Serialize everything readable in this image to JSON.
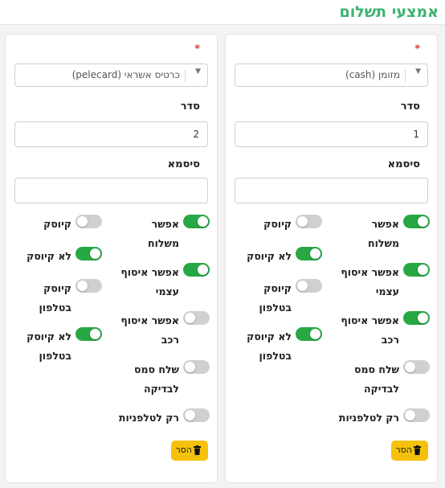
{
  "section": {
    "title": "אמצעי תשלום"
  },
  "cards": [
    {
      "required_mark": "*",
      "method_value": "מזומן (cash)",
      "order_label": "סדר",
      "order_value": "1",
      "password_label": "סיסמא",
      "password_value": "",
      "toggles": {
        "allow_delivery": {
          "label": "אפשר משלוח",
          "on": true
        },
        "allow_pickup": {
          "label": "אפשר איסוף עצמי",
          "on": true
        },
        "allow_car_pickup": {
          "label": "אפשר איסוף רכב",
          "on": true
        },
        "send_sms_test": {
          "label": "שלח סמס לבדיקה",
          "on": false
        },
        "phones_only": {
          "label": "רק לטלפניות",
          "on": false
        },
        "kiosk": {
          "label": "קיוסק",
          "on": false
        },
        "not_kiosk": {
          "label": "לא קיוסק",
          "on": true
        },
        "kiosk_phone": {
          "label": "קיוסק בטלפון",
          "on": false
        },
        "not_kiosk_phone": {
          "label": "לא קיוסק בטלפון",
          "on": true
        }
      },
      "remove_label": "הסר"
    },
    {
      "required_mark": "*",
      "method_value": "כרטיס אשראי (pelecard)",
      "order_label": "סדר",
      "order_value": "2",
      "password_label": "סיסמא",
      "password_value": "",
      "toggles": {
        "allow_delivery": {
          "label": "אפשר משלוח",
          "on": true
        },
        "allow_pickup": {
          "label": "אפשר איסוף עצמי",
          "on": true
        },
        "allow_car_pickup": {
          "label": "אפשר איסוף רכב",
          "on": false
        },
        "send_sms_test": {
          "label": "שלח סמס לבדיקה",
          "on": false
        },
        "phones_only": {
          "label": "רק לטלפניות",
          "on": false
        },
        "kiosk": {
          "label": "קיוסק",
          "on": false
        },
        "not_kiosk": {
          "label": "לא קיוסק",
          "on": true
        },
        "kiosk_phone": {
          "label": "קיוסק בטלפון",
          "on": false
        },
        "not_kiosk_phone": {
          "label": "לא קיוסק בטלפון",
          "on": true
        }
      },
      "remove_label": "הסר"
    }
  ],
  "colors": {
    "accent": "#3cb371",
    "switch_on": "#28a745",
    "switch_off": "#d0d0d0",
    "remove_button": "#f5c10b",
    "required": "#e53935"
  },
  "icons": {
    "caret": "caret-down-icon",
    "remove": "trash-icon"
  }
}
